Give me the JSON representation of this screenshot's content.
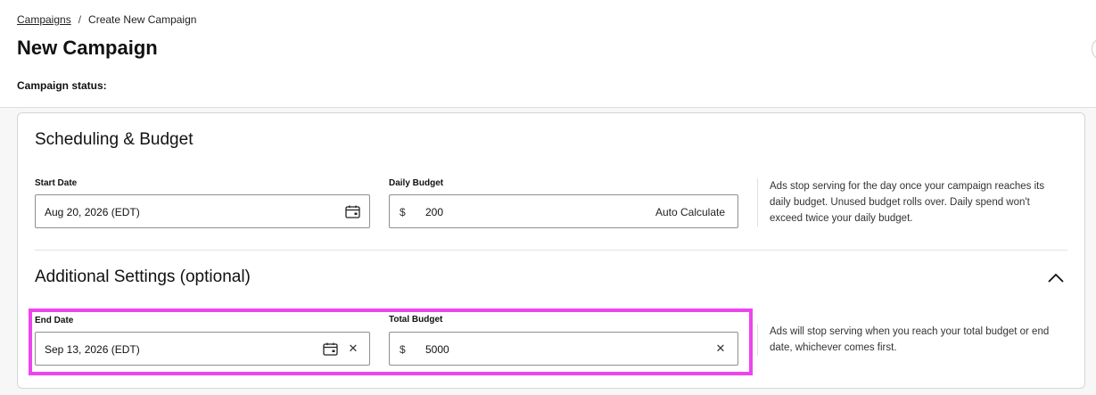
{
  "breadcrumb": {
    "parent": "Campaigns",
    "separator": "/",
    "current": "Create New Campaign"
  },
  "page": {
    "title": "New Campaign",
    "status_label": "Campaign status:"
  },
  "scheduling": {
    "title": "Scheduling & Budget",
    "start_date": {
      "label": "Start Date",
      "value": "Aug 20, 2026 (EDT)",
      "icon": "calendar-icon"
    },
    "daily_budget": {
      "label": "Daily Budget",
      "currency": "$",
      "value": "200",
      "auto_calculate_label": "Auto Calculate"
    },
    "help_text": "Ads stop serving for the day once your campaign reaches its daily budget. Unused budget rolls over. Daily spend won't exceed twice your daily budget."
  },
  "additional": {
    "title": "Additional Settings (optional)",
    "toggle_icon": "chevron-up-icon",
    "end_date": {
      "label": "End Date",
      "value": "Sep 13, 2026 (EDT)",
      "icon": "calendar-icon",
      "clear_icon": "close-icon"
    },
    "total_budget": {
      "label": "Total Budget",
      "currency": "$",
      "value": "5000",
      "clear_icon": "close-icon"
    },
    "help_text": "Ads will stop serving when you reach your total budget or end date, whichever comes first."
  },
  "colors": {
    "highlight": "#ee44ee",
    "input_border": "#8f8f8f",
    "card_border": "#d6d6d6"
  }
}
